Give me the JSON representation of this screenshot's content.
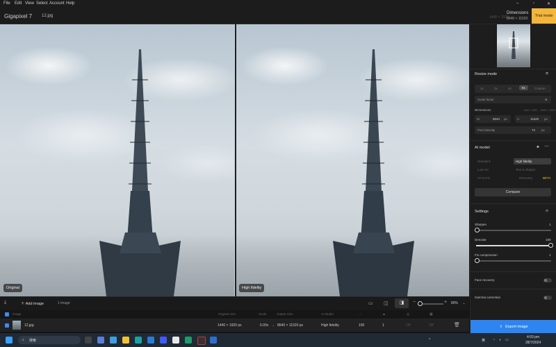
{
  "menu": [
    "File",
    "Edit",
    "View",
    "Select",
    "Account",
    "Help"
  ],
  "app": {
    "name": "Gigapixel 7",
    "file_tab": "12.jpg",
    "size_hint": "1440 × 1920",
    "dims_label": "Dimensions",
    "dims_value": "8640 × 11520",
    "trial": "Trial mode"
  },
  "viewer": {
    "left_badge": "Original",
    "right_badge": "High fidelity"
  },
  "sidebar": {
    "resize_title": "Resize mode",
    "scales": [
      "1x",
      "2x",
      "4x",
      "6x",
      "Custom"
    ],
    "active_scale": "6x",
    "scale_factor_label": "Scale factor",
    "scale_factor_value": "6",
    "dimensions_label": "Dimensions",
    "dimensions_hint": "1440 × 1920 → 8640 × 11520",
    "width_prefix": "W",
    "width_value": "8640",
    "height_prefix": "H",
    "height_value": "11520",
    "unit": "px",
    "pixel_density_label": "Pixel density",
    "pixel_density_value": "72",
    "ai_model_title": "AI model",
    "models": [
      "Standard",
      "High fidelity",
      "Low res",
      "Text & shapes",
      "Art & CG",
      "Recovery"
    ],
    "active_model": "High fidelity",
    "beta": "BETA",
    "compare": "Compare",
    "settings_title": "Settings",
    "sharpen_label": "Sharpen",
    "sharpen_value": "1",
    "denoise_label": "Denoise",
    "denoise_value": "100",
    "fix_label": "Fix compression",
    "fix_value": "1",
    "face_label": "Face recovery",
    "gamma_label": "Gamma correction",
    "export": "Export image"
  },
  "bottom": {
    "add_image": "Add image",
    "count": "1 image",
    "zoom": "80%"
  },
  "table": {
    "headers": [
      "Image",
      "Original size",
      "Scale",
      "Output Size",
      "AI Model"
    ],
    "row": {
      "name": "12.jpg",
      "original": "1440 × 1920 px",
      "scale": "6.00x",
      "arrow": "→",
      "output": "8640 × 11520 px",
      "model": "High fidelity",
      "v1": "100",
      "v2": "1",
      "v3": "Off",
      "v4": "Off"
    }
  },
  "taskbar": {
    "search": "搜索",
    "lang": "英",
    "time": "4:03 pm",
    "date": "28/7/2024"
  }
}
